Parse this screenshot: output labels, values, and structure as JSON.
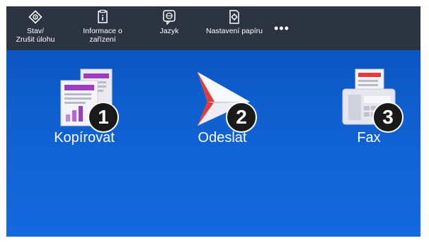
{
  "topbar": {
    "items": [
      {
        "label": "Stav/\nZrušit úlohu",
        "icon": "status-cancel-icon"
      },
      {
        "label": "Informace o\nzařízení",
        "icon": "device-info-icon"
      },
      {
        "label": "Jazyk",
        "icon": "language-icon"
      },
      {
        "label": "Nastavení papíru",
        "icon": "paper-settings-icon"
      }
    ],
    "more": "•••"
  },
  "tiles": [
    {
      "label": "Kopírovat",
      "badge": "1",
      "icon": "copy-icon"
    },
    {
      "label": "Odeslat",
      "badge": "2",
      "icon": "send-icon"
    },
    {
      "label": "Fax",
      "badge": "3",
      "icon": "fax-icon"
    }
  ],
  "colors": {
    "topbar": "#2c3442",
    "background": "#0f5fd0",
    "copy_accent": "#9b3fbf",
    "send_accent": "#e23b3b",
    "fax_accent": "#e23b3b"
  }
}
